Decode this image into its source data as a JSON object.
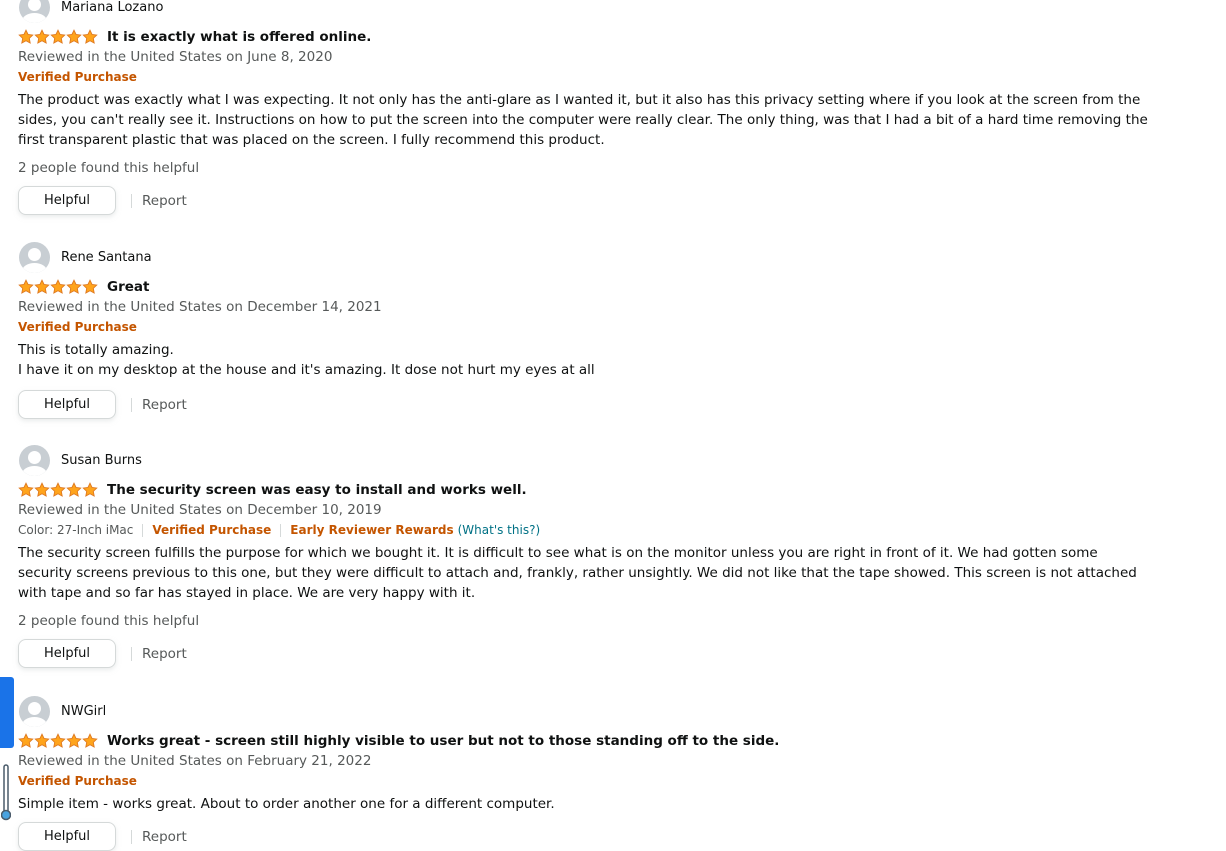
{
  "reviews": [
    {
      "name": "Mariana Lozano",
      "title": "It is exactly what is offered online.",
      "date": "Reviewed in the United States on June 8, 2020",
      "verified": "Verified Purchase",
      "body": [
        "The product was exactly what I was expecting. It not only has the anti-glare as I wanted it, but it also has this privacy setting where if you look at the screen from the sides, you can't really see it. Instructions on how to put the screen into the computer were really clear. The only thing, was that I had a bit of a hard time removing the first transparent plastic that was placed on the screen. I fully recommend this product."
      ],
      "helpful_count": "2 people found this helpful",
      "helpful_label": "Helpful",
      "report_label": "Report",
      "rating": 5
    },
    {
      "name": "Rene Santana",
      "title": "Great",
      "date": "Reviewed in the United States on December 14, 2021",
      "verified": "Verified Purchase",
      "body": [
        "This is totally amazing.",
        "I have it on my desktop at the house and it's amazing. It dose not hurt my eyes at all"
      ],
      "helpful_label": "Helpful",
      "report_label": "Report",
      "rating": 5
    },
    {
      "name": "Susan Burns",
      "title": "The security screen was easy to install and works well.",
      "date": "Reviewed in the United States on December 10, 2019",
      "color": "Color: 27-Inch iMac",
      "verified": "Verified Purchase",
      "early_reviewer": "Early Reviewer Rewards",
      "whats_this": "(What's this?)",
      "body": [
        "The security screen fulfills the purpose for which we bought it. It is difficult to see what is on the monitor unless you are right in front of it. We had gotten some security screens previous to this one, but they were difficult to attach and, frankly, rather unsightly. We did not like that the tape showed. This screen is not attached with tape and so far has stayed in place. We are very happy with it."
      ],
      "helpful_count": "2 people found this helpful",
      "helpful_label": "Helpful",
      "report_label": "Report",
      "rating": 5
    },
    {
      "name": "NWGirl",
      "title": "Works great - screen still highly visible to user but not to those standing off to the side.",
      "date": "Reviewed in the United States on February 21, 2022",
      "verified": "Verified Purchase",
      "body": [
        "Simple item - works great. About to order another one for a different computer."
      ],
      "helpful_label": "Helpful",
      "report_label": "Report",
      "rating": 5
    }
  ],
  "colors": {
    "star": "#ffa41c",
    "star_outline": "#de7921",
    "verified": "#c45500",
    "link": "#007185",
    "muted": "#565959"
  }
}
